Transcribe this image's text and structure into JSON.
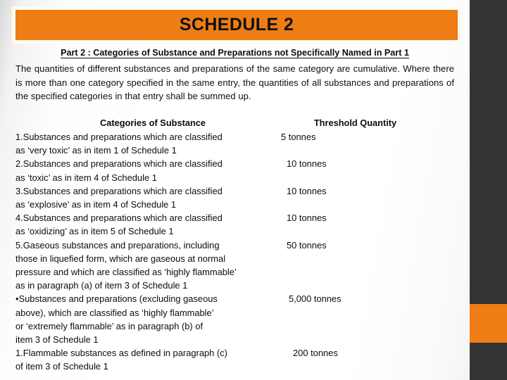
{
  "slide": {
    "title": "SCHEDULE 2",
    "accent_color": "#ED7D14",
    "rail_color": "#333333",
    "part_heading": "Part 2 : Categories of Substance and Preparations not Specifically Named in Part 1",
    "intro": "The quantities of different substances and preparations of the same category are cumulative. Where there is more than one category specified in the same entry, the quantities of all substances and preparations of the specified categories in that entry shall be summed up."
  },
  "table": {
    "headers": {
      "category": "Categories of Substance",
      "quantity": "Threshold Quantity"
    },
    "rows": [
      {
        "category": "1.Substances and preparations which are classified\nas ‘very toxic’ as in item 1 of Schedule 1",
        "quantity": "5 tonnes"
      },
      {
        "category": "2.Substances and preparations which are classified\nas ‘toxic’ as in item  4 of Schedule 1",
        "quantity": "10 tonnes"
      },
      {
        "category": "3.Substances and preparations which are classified\nas ‘explosive’ as in item  4 of Schedule 1",
        "quantity": "10 tonnes"
      },
      {
        "category": "4.Substances and preparations which are classified\nas ‘oxidizing’ as in item  5 of Schedule 1",
        "quantity": "10 tonnes"
      },
      {
        "category": "5.Gaseous substances and preparations, including\nthose in liquefied form, which are gaseous at normal\npressure and which are classified as ‘highly flammable’\nas in paragraph (a) of item  3 of Schedule 1",
        "quantity": "50 tonnes"
      },
      {
        "category": "•Substances and preparations (excluding gaseous\nabove), which are classified as ‘highly flammable’\nor ‘extremely flammable’ as in paragraph (b) of\nitem 3 of Schedule 1",
        "quantity": "5,000 tonnes"
      },
      {
        "category": "1.Flammable substances as defined in paragraph (c)\nof item 3 of Schedule 1",
        "quantity": "200 tonnes"
      }
    ]
  }
}
